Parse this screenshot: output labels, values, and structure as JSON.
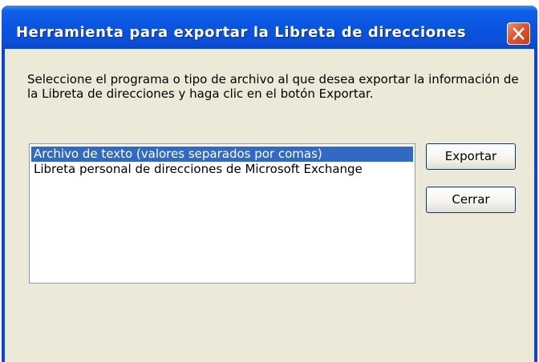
{
  "window": {
    "title": "Herramienta para exportar la Libreta de direcciones"
  },
  "instructions": "Seleccione el programa o tipo de archivo al que desea exportar la información de la Libreta de direcciones y haga clic en el botón Exportar.",
  "export_list": {
    "items": [
      {
        "label": "Archivo de texto (valores separados por comas)",
        "selected": true
      },
      {
        "label": "Libreta personal de direcciones de Microsoft Exchange",
        "selected": false
      }
    ]
  },
  "buttons": {
    "export_label": "Exportar",
    "close_label": "Cerrar"
  },
  "colors": {
    "titlebar": "#0a54e0",
    "dialog_background": "#ece9d8",
    "selection": "#316ac5",
    "close_button": "#e0542e"
  },
  "icons": {
    "close": "close-icon"
  }
}
